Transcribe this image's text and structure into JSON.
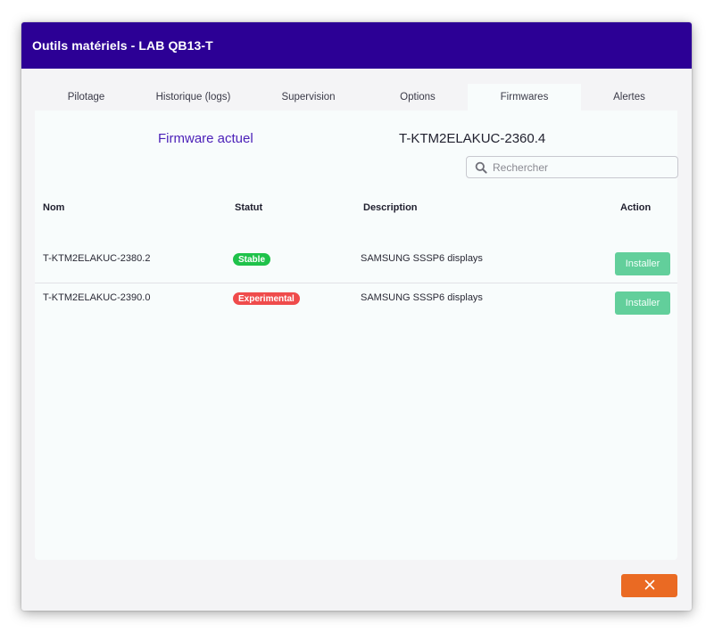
{
  "modal": {
    "title": "Outils matériels - LAB QB13-T"
  },
  "tabs": [
    {
      "label": "Pilotage"
    },
    {
      "label": "Historique (logs)"
    },
    {
      "label": "Supervision"
    },
    {
      "label": "Options"
    },
    {
      "label": "Firmwares"
    },
    {
      "label": "Alertes"
    }
  ],
  "firmware": {
    "current_label": "Firmware actuel",
    "current_value": "T-KTM2ELAKUC-2360.4"
  },
  "search": {
    "placeholder": "Rechercher",
    "value": ""
  },
  "table": {
    "headers": {
      "name": "Nom",
      "status": "Statut",
      "description": "Description",
      "action": "Action"
    },
    "rows": [
      {
        "name": "T-KTM2ELAKUC-2380.2",
        "status": "Stable",
        "description": "SAMSUNG SSSP6 displays",
        "action_label": "Installer"
      },
      {
        "name": "T-KTM2ELAKUC-2390.0",
        "status": "Experimental",
        "description": "SAMSUNG SSSP6 displays",
        "action_label": "Installer"
      }
    ]
  },
  "close_button": {
    "icon": "close-icon"
  },
  "colors": {
    "header_bg": "#2c0095",
    "accent_text": "#4a1fb8",
    "stable": "#1fc24a",
    "experimental": "#ef4b4b",
    "install": "#62cf9b",
    "close": "#ea6a23"
  }
}
